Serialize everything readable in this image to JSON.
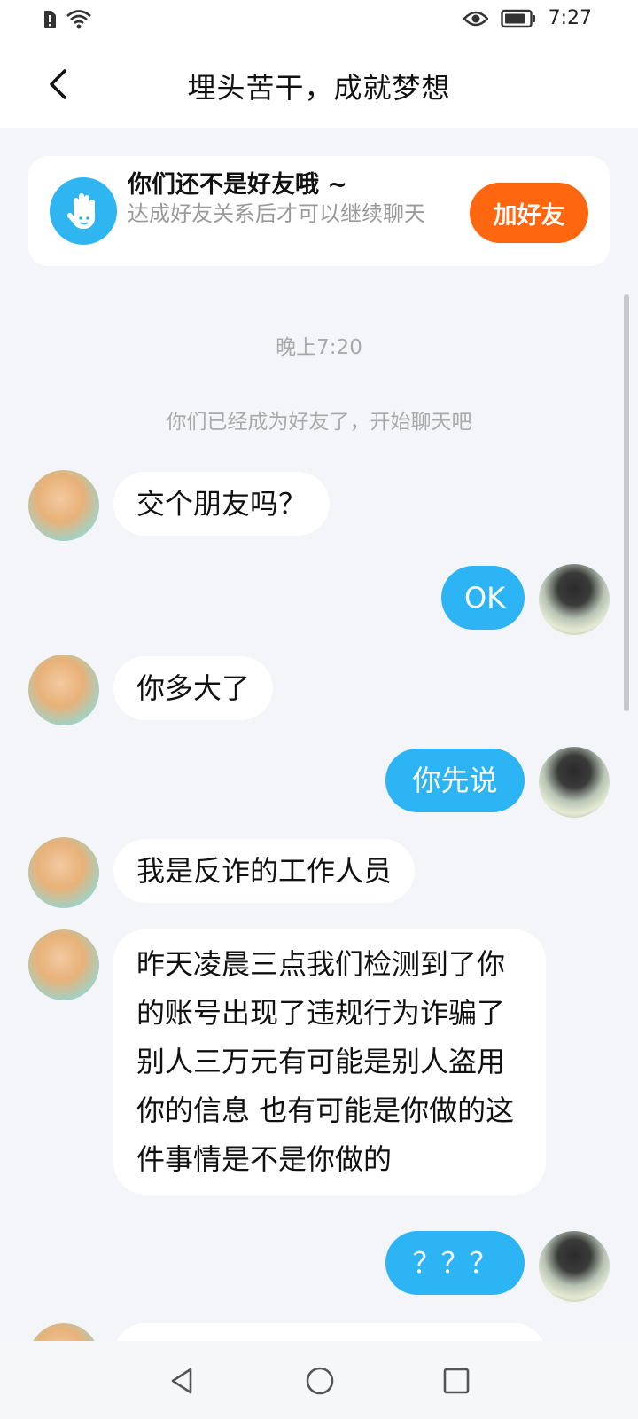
{
  "status_bar": {
    "time": "7:27"
  },
  "header": {
    "title": "埋头苦干，成就梦想"
  },
  "friend_card": {
    "title": "你们还不是好友哦 ~",
    "subtitle": "达成好友关系后才可以继续聊天",
    "button": "加好友"
  },
  "chat": {
    "time_label": "晚上7:20",
    "system_message": "你们已经成为好友了，开始聊天吧",
    "messages": [
      {
        "from": "other",
        "text": "交个朋友吗？"
      },
      {
        "from": "me",
        "text": "OK"
      },
      {
        "from": "other",
        "text": "你多大了"
      },
      {
        "from": "me",
        "text": "你先说"
      },
      {
        "from": "other",
        "text": "我是反诈的工作人员"
      },
      {
        "from": "other",
        "text": "昨天凌晨三点我们检测到了你的账号出现了违规行为诈骗了别人三万元有可能是别人盗用你的信息  也有可能是你做的这件事情是不是你做的"
      },
      {
        "from": "me",
        "text": "？？？"
      }
    ]
  },
  "colors": {
    "accent": "#2db4f5",
    "add_friend": "#ff6610",
    "background": "#f3f5f8"
  }
}
